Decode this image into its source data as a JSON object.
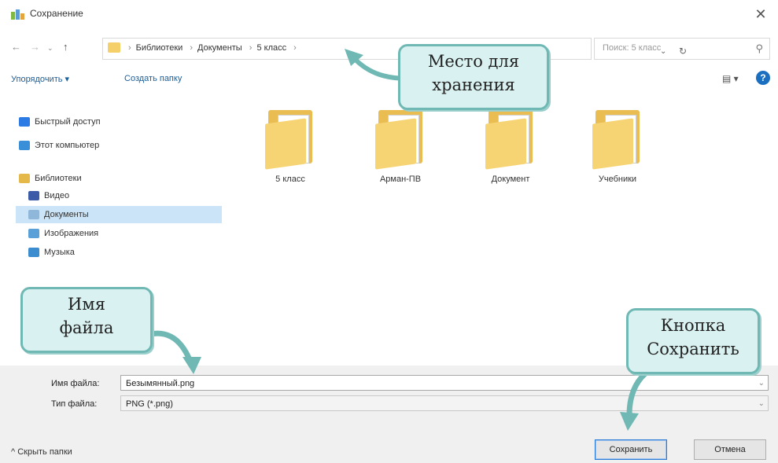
{
  "window": {
    "title": "Сохранение",
    "close_icon": "close-icon"
  },
  "address": {
    "crumbs": [
      "Библиотеки",
      "Документы",
      "5 класс"
    ],
    "search_placeholder": "Поиск: 5 класс"
  },
  "toolbar": {
    "organize": "Упорядочить ▾",
    "new_folder": "Создать папку",
    "help": "?"
  },
  "sidebar": {
    "items": [
      {
        "label": "Быстрый доступ",
        "icon": "star-icon",
        "color": "#2c7be5"
      },
      {
        "label": "Этот компьютер",
        "icon": "computer-icon",
        "color": "#3a8fd9"
      },
      {
        "label": "Библиотеки",
        "icon": "libraries-icon",
        "color": "#e5b84a"
      },
      {
        "label": "Видео",
        "icon": "video-icon",
        "color": "#3b5aa8"
      },
      {
        "label": "Документы",
        "icon": "documents-icon",
        "color": "#8fb7d9"
      },
      {
        "label": "Изображения",
        "icon": "images-icon",
        "color": "#5aa0d8"
      },
      {
        "label": "Музыка",
        "icon": "music-icon",
        "color": "#3c8dd0"
      }
    ],
    "selected_index": 4
  },
  "folders": [
    {
      "label": "5 класс"
    },
    {
      "label": "Арман-ПВ"
    },
    {
      "label": "Документ"
    },
    {
      "label": "Учебники"
    }
  ],
  "form": {
    "filename_label": "Имя файла:",
    "filename_value": "Безымянный.png",
    "filetype_label": "Тип файла:",
    "filetype_value": "PNG (*.png)"
  },
  "footer": {
    "hide_folders": "Скрыть папки",
    "save": "Сохранить",
    "cancel": "Отмена"
  },
  "callouts": {
    "location": [
      "Место для",
      "хранения"
    ],
    "filename": [
      "Имя",
      "файла"
    ],
    "save": [
      "Кнопка",
      "Сохранить"
    ]
  },
  "colors": {
    "callout_bg": "#d9f2f1",
    "callout_border": "#6fb8b4",
    "selected": "#cce4f7",
    "link": "#1a5f9c"
  }
}
